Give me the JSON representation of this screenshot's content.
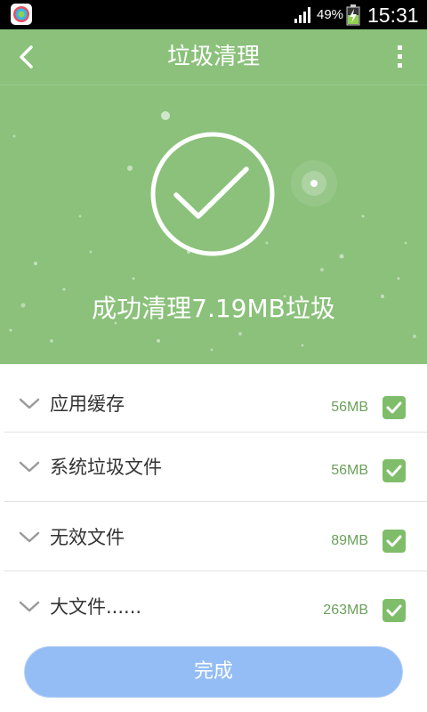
{
  "status_bar": {
    "app_icon": "shield-app-icon",
    "signal_icon": "signal-bars-icon",
    "battery_percent": "49%",
    "battery_icon": "battery-charging-icon",
    "time": "15:31"
  },
  "toolbar": {
    "back_icon": "chevron-left-icon",
    "title": "垃圾清理",
    "menu_icon": "more-vertical-icon"
  },
  "hero": {
    "status_icon": "check-circle-icon",
    "result_text": "成功清理7.19MB垃圾"
  },
  "items": [
    {
      "label": "应用缓存",
      "size": "56MB",
      "checked": true
    },
    {
      "label": "系统垃圾文件",
      "size": "56MB",
      "checked": true
    },
    {
      "label": "无效文件",
      "size": "89MB",
      "checked": true
    },
    {
      "label": "大文件......",
      "size": "263MB",
      "checked": true
    }
  ],
  "done_button": {
    "label": "完成"
  },
  "colors": {
    "hero_green": "#8bc17b",
    "accent_green": "#7fbd6a",
    "size_text": "#6aa15a",
    "button_blue": "#93bdf4"
  }
}
